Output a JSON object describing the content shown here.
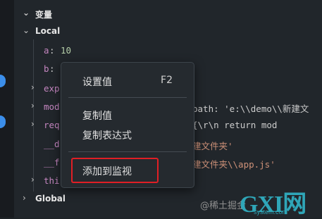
{
  "panel": {
    "title": "变量",
    "local_label": "Local",
    "global_label": "Global"
  },
  "variables": [
    {
      "name": "a",
      "sep": ":",
      "value": "10"
    },
    {
      "name": "b",
      "sep": ":",
      "value": ""
    },
    {
      "name": "exp",
      "value": ""
    },
    {
      "name": "mod",
      "value": "path: 'e:\\\\demo\\\\新建文"
    },
    {
      "name": "req",
      "value": "{\\r\\n      return mod"
    },
    {
      "name": "__d",
      "value": "建文件夹'"
    },
    {
      "name": "__f",
      "value": "建文件夹\\\\app.js'"
    },
    {
      "name": "thi",
      "value": ""
    }
  ],
  "context_menu": {
    "set_value": "设置值",
    "set_value_key": "F2",
    "copy_value": "复制值",
    "copy_expression": "复制表达式",
    "add_to_watch": "添加到监视"
  },
  "watermark": "@稀土掘金",
  "logo": {
    "main": "GXI网",
    "sub": "system.com"
  },
  "colors": {
    "highlight": "#e01f25",
    "accent": "#3b8eea"
  }
}
